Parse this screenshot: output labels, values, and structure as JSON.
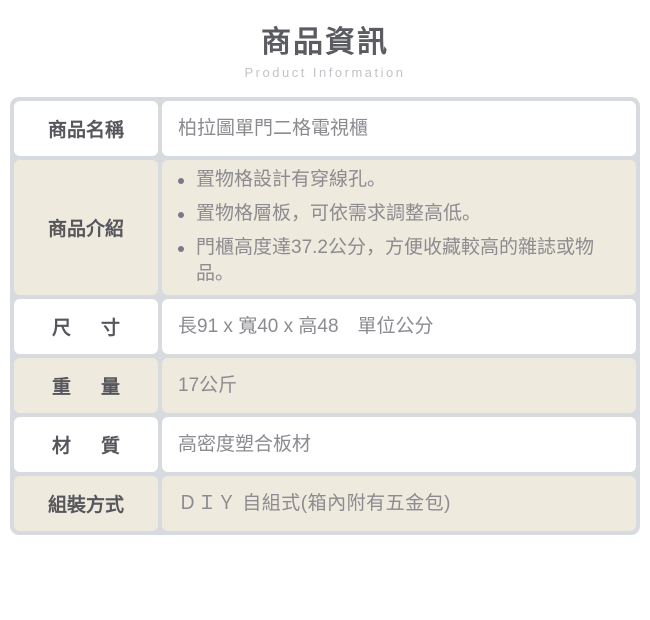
{
  "header": {
    "title": "商品資訊",
    "subtitle": "Product Information"
  },
  "table": {
    "rows": [
      {
        "label": "商品名稱",
        "value": "柏拉圖單門二格電視櫃",
        "tone": "light",
        "spaced": false
      },
      {
        "label": "商品介紹",
        "tone": "dark",
        "spaced": false,
        "bullets": [
          "置物格設計有穿線孔。",
          "置物格層板，可依需求調整高低。",
          "門櫃高度達37.2公分，方便收藏較高的雜誌或物品。"
        ]
      },
      {
        "label": "尺寸",
        "value": "長91 x 寬40 x 高48　單位公分",
        "tone": "light",
        "spaced": true
      },
      {
        "label": "重量",
        "value": "17公斤",
        "tone": "dark",
        "spaced": true
      },
      {
        "label": "材質",
        "value": "高密度塑合板材",
        "tone": "light",
        "spaced": true
      },
      {
        "label": "組裝方式",
        "value": "ＤＩＹ 自組式(箱內附有五金包)",
        "tone": "dark",
        "spaced": false
      }
    ]
  },
  "colors": {
    "background": "#ffffff",
    "table_gap": "#d7dade",
    "row_light": "#ffffff",
    "row_dark": "#efeade",
    "label_text": "#56565c",
    "value_text": "#8b8b90",
    "title_text": "#5b5b62",
    "subtitle_text": "#c3c3c8",
    "bullet_dot": "#7d7886"
  }
}
